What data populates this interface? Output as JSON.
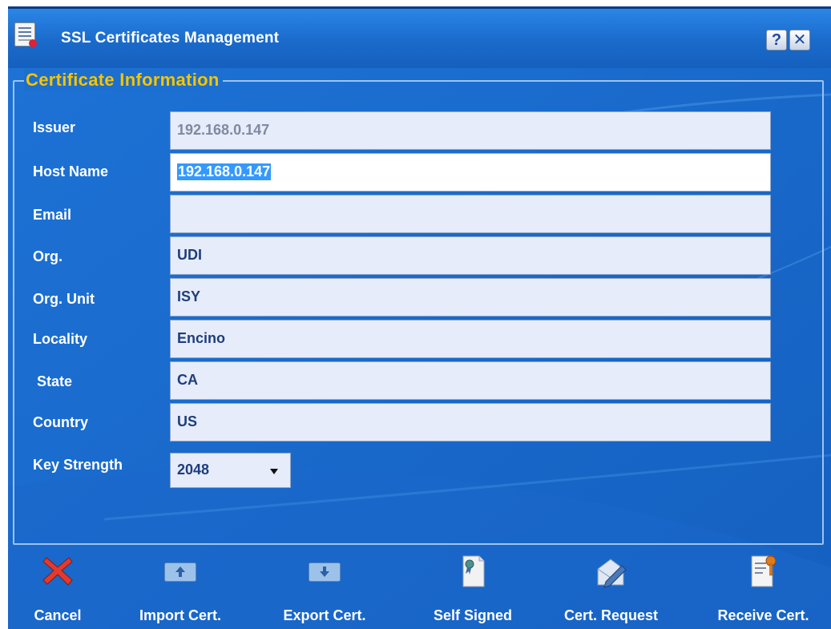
{
  "window": {
    "title": "SSL Certificates Management",
    "help_glyph": "?",
    "close_glyph": "✕"
  },
  "section": {
    "title": "Certificate Information"
  },
  "form": {
    "issuer": {
      "label": "Issuer",
      "value": "192.168.0.147"
    },
    "host_name": {
      "label": "Host Name",
      "value": "192.168.0.147"
    },
    "email": {
      "label": "Email",
      "value": ""
    },
    "org": {
      "label": "Org.",
      "value": "UDI"
    },
    "org_unit": {
      "label": "Org. Unit",
      "value": "ISY"
    },
    "locality": {
      "label": "Locality",
      "value": "Encino"
    },
    "state": {
      "label": "State",
      "value": "CA"
    },
    "country": {
      "label": "Country",
      "value": "US"
    },
    "key_strength": {
      "label": "Key Strength",
      "value": "2048"
    }
  },
  "toolbar": {
    "cancel": {
      "label": "Cancel",
      "icon": "red-x-icon"
    },
    "import": {
      "label": "Import Cert.",
      "icon": "import-tray-icon"
    },
    "export": {
      "label": "Export Cert.",
      "icon": "export-tray-icon"
    },
    "self_signed": {
      "label": "Self Signed",
      "icon": "certificate-ribbon-icon"
    },
    "cert_request": {
      "label": "Cert. Request",
      "icon": "envelope-pen-icon"
    },
    "receive": {
      "label": "Receive Cert.",
      "icon": "certificate-key-icon"
    }
  },
  "colors": {
    "window_blue": "#1c6fd0",
    "section_title": "#f5c400",
    "field_bg": "#e6ecf9",
    "selection": "#3399ff"
  }
}
